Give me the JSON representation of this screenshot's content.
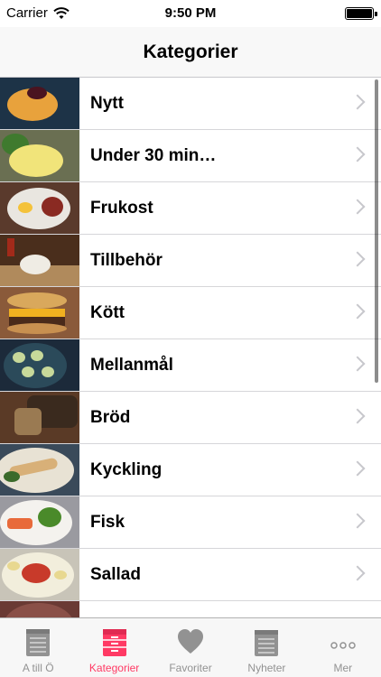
{
  "status_bar": {
    "carrier": "Carrier",
    "time": "9:50 PM"
  },
  "nav": {
    "title": "Kategorier"
  },
  "categories": [
    {
      "label": "Nytt",
      "thumb_icon": "food-photo-icon"
    },
    {
      "label": "Under 30 min…",
      "thumb_icon": "food-photo-icon"
    },
    {
      "label": "Frukost",
      "thumb_icon": "food-photo-icon"
    },
    {
      "label": "Tillbehör",
      "thumb_icon": "food-photo-icon"
    },
    {
      "label": "Kött",
      "thumb_icon": "food-photo-icon"
    },
    {
      "label": "Mellanmål",
      "thumb_icon": "food-photo-icon"
    },
    {
      "label": "Bröd",
      "thumb_icon": "food-photo-icon"
    },
    {
      "label": "Kyckling",
      "thumb_icon": "food-photo-icon"
    },
    {
      "label": "Fisk",
      "thumb_icon": "food-photo-icon"
    },
    {
      "label": "Sallad",
      "thumb_icon": "food-photo-icon"
    },
    {
      "label": "",
      "thumb_icon": "food-photo-icon"
    }
  ],
  "tabs": [
    {
      "label": "A till Ö",
      "icon": "notebook-icon",
      "active": false
    },
    {
      "label": "Kategorier",
      "icon": "cabinet-icon",
      "active": true
    },
    {
      "label": "Favoriter",
      "icon": "heart-icon",
      "active": false
    },
    {
      "label": "Nyheter",
      "icon": "notepad-icon",
      "active": false
    },
    {
      "label": "Mer",
      "icon": "more-icon",
      "active": false
    }
  ],
  "colors": {
    "accent": "#ff3a64",
    "inactive": "#929292"
  }
}
